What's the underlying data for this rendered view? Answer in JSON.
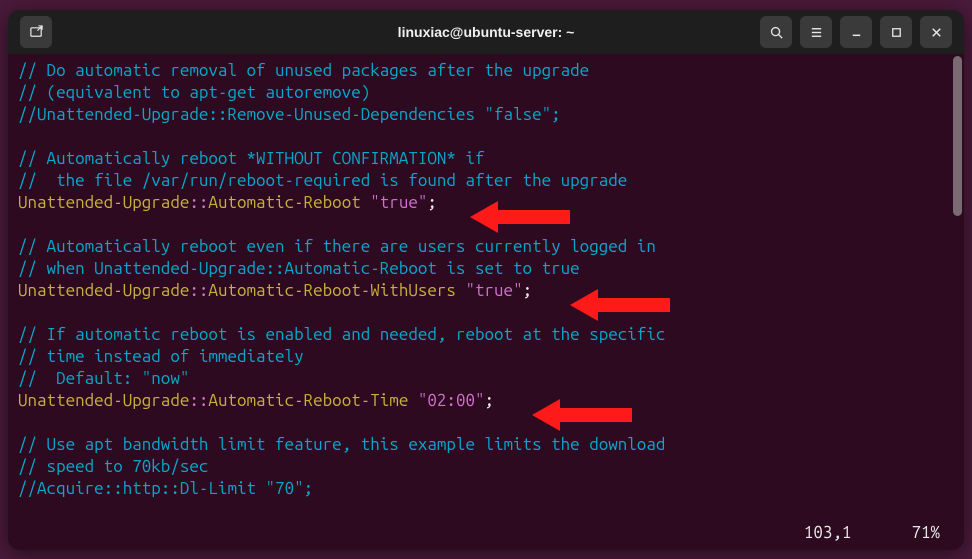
{
  "window": {
    "title": "linuxiac@ubuntu-server: ~"
  },
  "icons": {
    "newtab": "new-tab-icon",
    "search": "search-icon",
    "menu": "hamburger-icon",
    "min": "minimize-icon",
    "max": "maximize-icon",
    "close": "close-icon"
  },
  "lines": {
    "l1": "// Do automatic removal of unused packages after the upgrade",
    "l2": "// (equivalent to apt-get autoremove)",
    "l3a": "//Unattended-Upgrade::Remove-Unused-Dependencies ",
    "l3b": "\"false\"",
    "l3c": ";",
    "l4": "",
    "l5": "// Automatically reboot *WITHOUT CONFIRMATION* if",
    "l6": "//  the file /var/run/reboot-required is found after the upgrade",
    "l7a": "Unattended-Upgrade",
    "l7b": "::",
    "l7c": "Automatic-Reboot ",
    "l7d": "\"true\"",
    "l7e": ";",
    "l8": "",
    "l9": "// Automatically reboot even if there are users currently logged in",
    "l10": "// when Unattended-Upgrade::Automatic-Reboot is set to true",
    "l11a": "Unattended-Upgrade",
    "l11b": "::",
    "l11c": "Automatic-Reboot-WithUsers ",
    "l11d": "\"true\"",
    "l11e": ";",
    "l12": "",
    "l13": "// If automatic reboot is enabled and needed, reboot at the specific",
    "l14": "// time instead of immediately",
    "l15": "//  Default: \"now\"",
    "l16a": "Unattended-Upgrade",
    "l16b": "::",
    "l16c": "Automatic-Reboot-Time ",
    "l16d": "\"02:00\"",
    "l16e": ";",
    "l17": "",
    "l18": "// Use apt bandwidth limit feature, this example limits the download",
    "l19": "// speed to 70kb/sec",
    "l20a": "//Acquire::http::Dl-Limit ",
    "l20b": "\"70\"",
    "l20c": ";"
  },
  "status": {
    "pos": "103,1",
    "pct": "71%"
  }
}
